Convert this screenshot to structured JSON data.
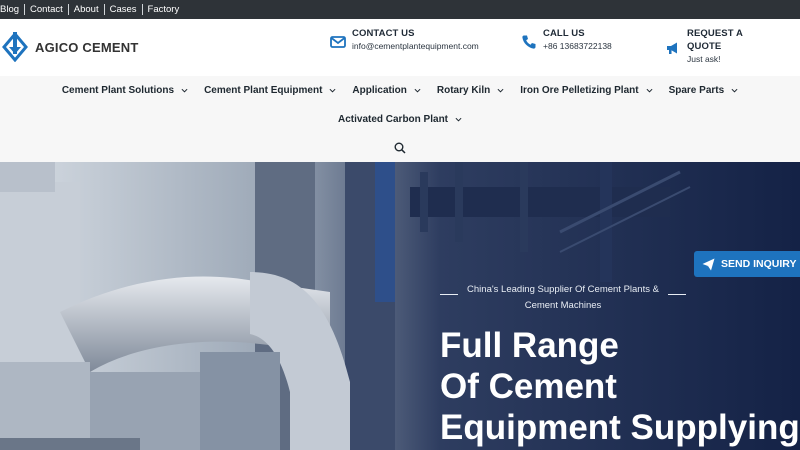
{
  "topbar": {
    "links": [
      "Blog",
      "Contact",
      "About",
      "Cases",
      "Factory"
    ]
  },
  "brand": {
    "name": "AGICO CEMENT"
  },
  "contact": {
    "email_title": "CONTACT US",
    "email": "info@cementplantequipment.com",
    "call_title": "CALL US",
    "phone": "+86 13683722138",
    "quote_title_1": "REQUEST A",
    "quote_title_2": "QUOTE",
    "quote_sub": "Just ask!"
  },
  "nav": {
    "items": [
      "Cement Plant Solutions",
      "Cement Plant Equipment",
      "Application",
      "Rotary Kiln",
      "Iron Ore Pelletizing Plant",
      "Spare Parts",
      "Activated Carbon Plant"
    ]
  },
  "hero": {
    "tagline_1": "China's Leading Supplier Of Cement Plants &",
    "tagline_2": "Cement Machines",
    "headline_1": "Full Range",
    "headline_2": "Of Cement",
    "headline_3": "Equipment Supplying"
  },
  "inquiry": {
    "label": "SEND INQUIRY"
  },
  "colors": {
    "topbar_bg": "#2e3338",
    "accent": "#1e73be",
    "nav_bg": "#f7f7f7",
    "hero_overlay": "#1c2a4a"
  },
  "icons": [
    "envelope-icon",
    "phone-icon",
    "megaphone-icon",
    "search-icon",
    "chevron-down-icon",
    "paper-plane-icon",
    "logo-mark-icon"
  ]
}
